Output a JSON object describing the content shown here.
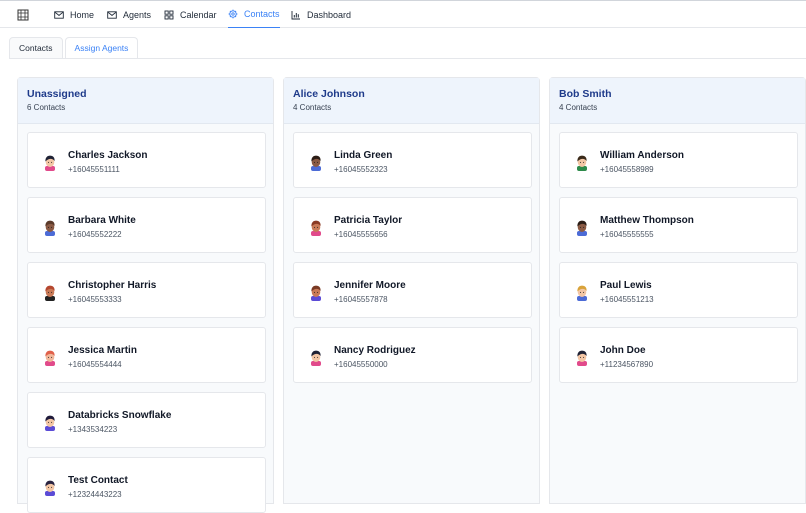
{
  "nav": {
    "items": [
      {
        "label": "Home",
        "icon": "mail-icon"
      },
      {
        "label": "Agents",
        "icon": "mail-icon"
      },
      {
        "label": "Calendar",
        "icon": "grid-icon"
      },
      {
        "label": "Contacts",
        "icon": "gear-icon"
      },
      {
        "label": "Dashboard",
        "icon": "bar-chart-icon"
      }
    ],
    "active": "Contacts",
    "accent_color": "#3b82f6"
  },
  "tabs": [
    {
      "label": "Contacts"
    },
    {
      "label": "Assign Agents"
    }
  ],
  "columns": [
    {
      "title": "Unassigned",
      "count": "6 Contacts",
      "contacts": [
        {
          "name": "Charles Jackson",
          "phone": "+16045551111",
          "skin": "#f3c6a5",
          "hair": "#1f2235",
          "shirt": "#e14a8b"
        },
        {
          "name": "Barbara White",
          "phone": "+16045552222",
          "skin": "#8a5a44",
          "hair": "#5b3a2a",
          "shirt": "#4c6bd6"
        },
        {
          "name": "Christopher Harris",
          "phone": "+16045553333",
          "skin": "#c97a57",
          "hair": "#b5472f",
          "shirt": "#222"
        },
        {
          "name": "Jessica Martin",
          "phone": "+16045554444",
          "skin": "#f1b79a",
          "hair": "#e0604a",
          "shirt": "#e14a8b"
        },
        {
          "name": "Databricks Snowflake",
          "phone": "+1343534223",
          "skin": "#f3c6a5",
          "hair": "#1f1a3a",
          "shirt": "#5b4bd6"
        },
        {
          "name": "Test Contact",
          "phone": "+12324443223",
          "skin": "#f3c6a5",
          "hair": "#2a2340",
          "shirt": "#5b4bd6"
        }
      ]
    },
    {
      "title": "Alice Johnson",
      "count": "4 Contacts",
      "contacts": [
        {
          "name": "Linda Green",
          "phone": "+16045552323",
          "skin": "#8a5a44",
          "hair": "#2b1d16",
          "shirt": "#4c6bd6"
        },
        {
          "name": "Patricia Taylor",
          "phone": "+16045555656",
          "skin": "#c97a57",
          "hair": "#8a3a24",
          "shirt": "#e14a8b"
        },
        {
          "name": "Jennifer Moore",
          "phone": "+16045557878",
          "skin": "#c97a57",
          "hair": "#7a3a24",
          "shirt": "#5b4bd6"
        },
        {
          "name": "Nancy Rodriguez",
          "phone": "+16045550000",
          "skin": "#f3c6a5",
          "hair": "#1f2235",
          "shirt": "#e14a8b"
        }
      ]
    },
    {
      "title": "Bob Smith",
      "count": "4 Contacts",
      "contacts": [
        {
          "name": "William Anderson",
          "phone": "+16045558989",
          "skin": "#f3c6a5",
          "hair": "#3a2a1a",
          "shirt": "#2d8a4a"
        },
        {
          "name": "Matthew Thompson",
          "phone": "+16045555555",
          "skin": "#8a5a44",
          "hair": "#2b1d16",
          "shirt": "#4c6bd6"
        },
        {
          "name": "Paul Lewis",
          "phone": "+16045551213",
          "skin": "#f3c6a5",
          "hair": "#d9a33a",
          "shirt": "#4c6bd6"
        },
        {
          "name": "John Doe",
          "phone": "+11234567890",
          "skin": "#f3c6a5",
          "hair": "#1f2235",
          "shirt": "#e14a8b"
        }
      ]
    }
  ]
}
